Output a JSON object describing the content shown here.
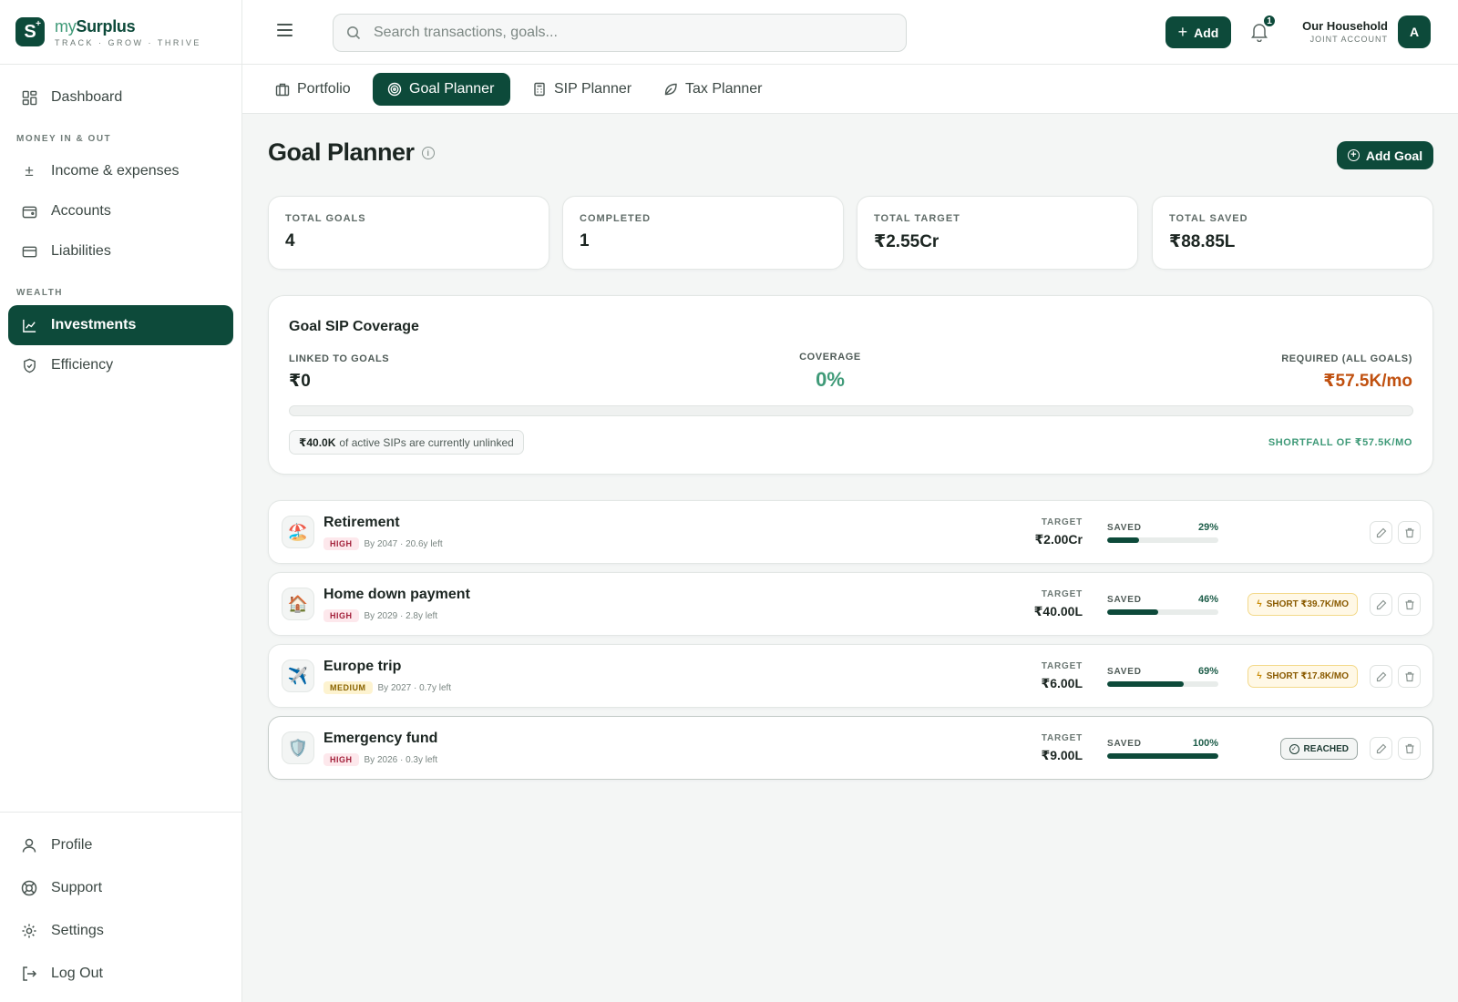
{
  "brand": {
    "name_prefix": "my",
    "name_main": "Surplus",
    "tagline": "TRACK · GROW · THRIVE",
    "logo_letter": "S"
  },
  "sidebar": {
    "top_items": [
      {
        "label": "Dashboard",
        "icon": "grid-icon"
      }
    ],
    "sections": [
      {
        "title": "MONEY IN & OUT",
        "items": [
          {
            "label": "Income & expenses",
            "icon": "plus-minus-icon"
          },
          {
            "label": "Accounts",
            "icon": "wallet-icon"
          },
          {
            "label": "Liabilities",
            "icon": "credit-card-icon"
          }
        ]
      },
      {
        "title": "WEALTH",
        "items": [
          {
            "label": "Investments",
            "icon": "line-chart-icon",
            "active": true
          },
          {
            "label": "Efficiency",
            "icon": "shield-check-icon"
          }
        ]
      }
    ],
    "bottom_items": [
      {
        "label": "Profile",
        "icon": "user-icon"
      },
      {
        "label": "Support",
        "icon": "lifebuoy-icon"
      },
      {
        "label": "Settings",
        "icon": "gear-icon"
      },
      {
        "label": "Log Out",
        "icon": "logout-icon"
      }
    ]
  },
  "topbar": {
    "search_placeholder": "Search transactions, goals...",
    "add_label": "Add",
    "notification_count": "1",
    "household_name": "Our Household",
    "household_sub": "JOINT ACCOUNT",
    "avatar_letter": "A"
  },
  "tabs": [
    {
      "label": "Portfolio",
      "icon": "briefcase-icon"
    },
    {
      "label": "Goal Planner",
      "icon": "target-icon",
      "active": true
    },
    {
      "label": "SIP Planner",
      "icon": "calculator-icon"
    },
    {
      "label": "Tax Planner",
      "icon": "leaf-icon"
    }
  ],
  "page": {
    "title": "Goal Planner",
    "info_icon": "info-icon",
    "add_goal_label": "Add Goal"
  },
  "stats": [
    {
      "label": "TOTAL GOALS",
      "value": "4"
    },
    {
      "label": "COMPLETED",
      "value": "1"
    },
    {
      "label": "TOTAL TARGET",
      "value": "₹2.55Cr"
    },
    {
      "label": "TOTAL SAVED",
      "value": "₹88.85L"
    }
  ],
  "coverage": {
    "title": "Goal SIP Coverage",
    "linked_label": "LINKED TO GOALS",
    "linked_value": "₹0",
    "coverage_label": "COVERAGE",
    "coverage_value": "0%",
    "coverage_fraction": 0,
    "required_label": "REQUIRED (ALL GOALS)",
    "required_value": "₹57.5K/mo",
    "unlinked_amount": "₹40.0K",
    "unlinked_text": "of active SIPs are currently unlinked",
    "shortfall_text": "SHORTFALL OF ₹57.5K/MO"
  },
  "goals_labels": {
    "target": "TARGET",
    "saved": "SAVED"
  },
  "goals": [
    {
      "name": "Retirement",
      "emoji": "🏖️",
      "priority": "HIGH",
      "priority_level": "high",
      "timeline": "By 2047 · 20.6y left",
      "target": "₹2.00Cr",
      "saved_pct_label": "29%",
      "saved_fraction": 0.29,
      "status": "",
      "status_type": "none"
    },
    {
      "name": "Home down payment",
      "emoji": "🏠",
      "priority": "HIGH",
      "priority_level": "high",
      "timeline": "By 2029 · 2.8y left",
      "target": "₹40.00L",
      "saved_pct_label": "46%",
      "saved_fraction": 0.46,
      "status": "SHORT ₹39.7K/MO",
      "status_type": "short"
    },
    {
      "name": "Europe trip",
      "emoji": "✈️",
      "priority": "MEDIUM",
      "priority_level": "medium",
      "timeline": "By 2027 · 0.7y left",
      "target": "₹6.00L",
      "saved_pct_label": "69%",
      "saved_fraction": 0.69,
      "status": "SHORT ₹17.8K/MO",
      "status_type": "short"
    },
    {
      "name": "Emergency fund",
      "emoji": "🛡️",
      "priority": "HIGH",
      "priority_level": "high",
      "timeline": "By 2026 · 0.3y left",
      "target": "₹9.00L",
      "saved_pct_label": "100%",
      "saved_fraction": 1.0,
      "status": "REACHED",
      "status_type": "reached"
    }
  ]
}
